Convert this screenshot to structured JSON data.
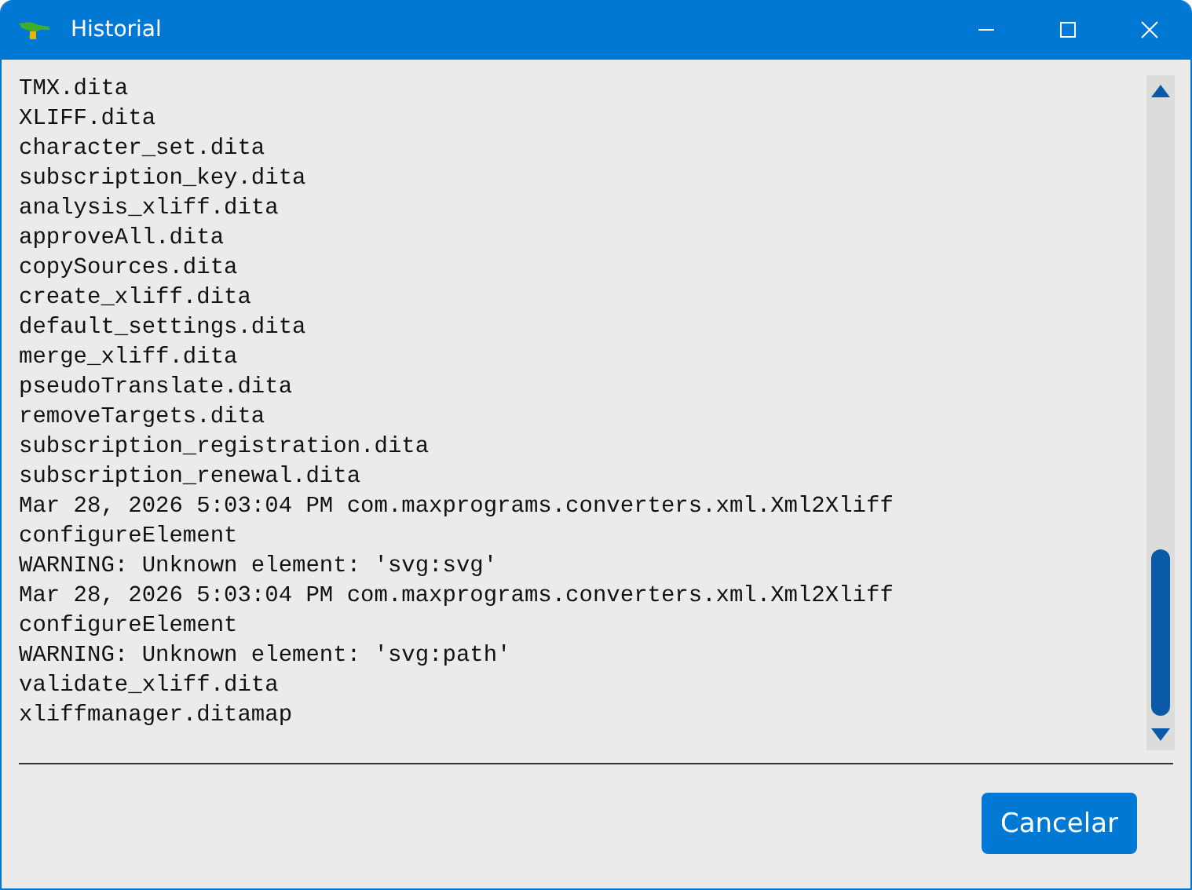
{
  "window": {
    "title": "Historial"
  },
  "log_lines": [
    "TMX.dita",
    "XLIFF.dita",
    "character_set.dita",
    "subscription_key.dita",
    "analysis_xliff.dita",
    "approveAll.dita",
    "copySources.dita",
    "create_xliff.dita",
    "default_settings.dita",
    "merge_xliff.dita",
    "pseudoTranslate.dita",
    "removeTargets.dita",
    "subscription_registration.dita",
    "subscription_renewal.dita",
    "Mar 28, 2026 5:03:04 PM com.maxprograms.converters.xml.Xml2Xliff",
    "configureElement",
    "WARNING: Unknown element: 'svg:svg'",
    "Mar 28, 2026 5:03:04 PM com.maxprograms.converters.xml.Xml2Xliff",
    "configureElement",
    "WARNING: Unknown element: 'svg:path'",
    "validate_xliff.dita",
    "xliffmanager.ditamap"
  ],
  "buttons": [
    {
      "label": "Cancelar"
    }
  ]
}
